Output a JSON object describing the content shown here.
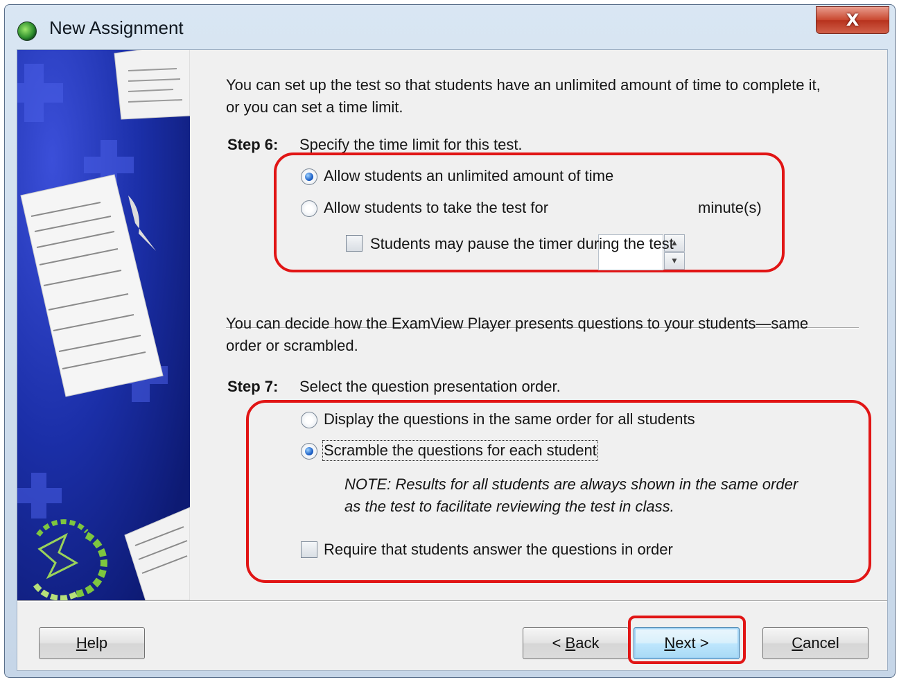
{
  "window": {
    "title": "New Assignment",
    "close_label": "X"
  },
  "step6": {
    "intro": "You can set up the test so that students have an unlimited amount of time to complete it, or you can set a time limit.",
    "label": "Step 6:",
    "text": "Specify the time limit for this test.",
    "options": [
      {
        "label": "Allow students an unlimited amount of time",
        "checked": true
      },
      {
        "label": "Allow students to take the test for",
        "checked": false
      }
    ],
    "minutes_value": "",
    "minutes_unit": "minute(s)",
    "pause_label": "Students may pause the timer during the test",
    "pause_checked": false
  },
  "step7": {
    "intro": "You can decide how the ExamView Player presents questions to your students—same order or scrambled.",
    "label": "Step 7:",
    "text": "Select the question presentation order.",
    "options": [
      {
        "label": "Display the questions in the same order for all students",
        "checked": false
      },
      {
        "label": "Scramble the questions for each student",
        "checked": true
      }
    ],
    "note_line1": "NOTE: Results for all students are always shown in the same order",
    "note_line2": "as the test to facilitate reviewing the test in class.",
    "require_label": "Require that students answer the questions in order",
    "require_checked": false
  },
  "buttons": {
    "help": {
      "prefix": "",
      "mnemonic": "H",
      "suffix": "elp"
    },
    "back": {
      "prefix": "< ",
      "mnemonic": "B",
      "suffix": "ack"
    },
    "next": {
      "prefix": "",
      "mnemonic": "N",
      "suffix": "ext >"
    },
    "cancel": {
      "prefix": "",
      "mnemonic": "C",
      "suffix": "ancel"
    }
  },
  "colors": {
    "highlight": "#e11515",
    "accent": "#1f63c9"
  }
}
